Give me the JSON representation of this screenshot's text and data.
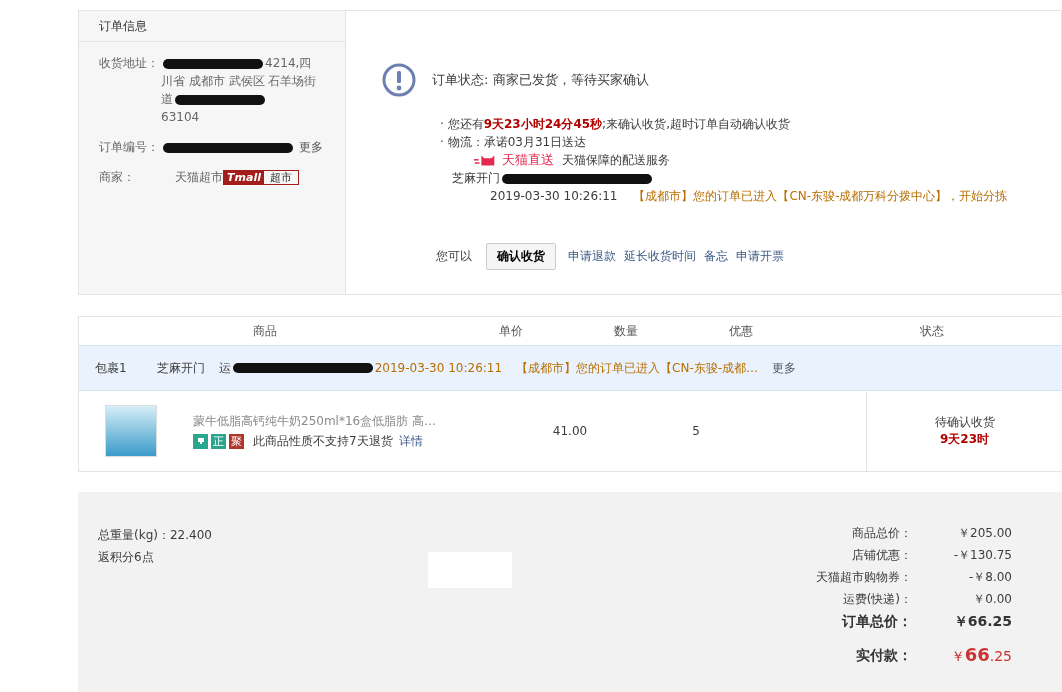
{
  "order_info": {
    "title": "订单信息",
    "fields": [
      {
        "kind": "address",
        "label": "收货地址：",
        "segments": [
          {
            "kind": "redacted"
          },
          {
            "kind": "text",
            "text": "4214,四"
          },
          {
            "kind": "text",
            "text": "川省 成都市 武侯区 石羊场街"
          },
          {
            "kind": "text",
            "text": "道"
          },
          {
            "kind": "redacted"
          },
          {
            "kind": "text",
            "text": "63104"
          }
        ]
      },
      {
        "kind": "order_no",
        "label": "订单编号：",
        "segments": [
          {
            "kind": "redacted"
          },
          {
            "kind": "more",
            "text": "更多"
          }
        ]
      },
      {
        "kind": "merchant",
        "label": "商家：",
        "segments": [
          {
            "kind": "text",
            "text": "天猫超市"
          },
          {
            "kind": "logo",
            "brand": "Tmall",
            "name": "超市"
          }
        ]
      }
    ]
  },
  "status": {
    "title": "订单状态: 商家已发货，等待买家确认",
    "bullets": [
      "· 您还有**9天23小时24分45秒**;来确认收货,超时订单自动确认收货",
      "· 物流：承诺03月31日送达"
    ],
    "delivery": {
      "badge": "天猫直送",
      "text": "天猫保障的配送服务"
    },
    "courier": {
      "text": "芝麻开门"
    },
    "track": {
      "time": "2019-03-30 10:26:11",
      "event": "【成都市】您的订单已进入【CN-东骏-成都万科分拨中心】，开始分拣"
    },
    "actions": {
      "label": "您可以",
      "button": "确认收货",
      "links": [
        "申请退款",
        "延长收货时间",
        "备忘",
        "申请开票"
      ]
    }
  },
  "table": {
    "columns": [
      "商品",
      "单价",
      "数量",
      "优惠",
      "状态"
    ],
    "package": {
      "label": "包裹1",
      "courier": "芝麻开门",
      "waybill": "运",
      "time": "2019-03-30 10:26:11",
      "event": "【成都市】您的订单已进入【CN-东骏-成都…",
      "more": "更多"
    },
    "rows": [
      {
        "name": "蒙牛低脂高钙纯牛奶250ml*16盒低脂肪 高…",
        "badges": [
          {
            "kind": "icon",
            "color": "#2aa58e"
          },
          {
            "kind": "text",
            "text": "正",
            "color": "#2aa58e"
          },
          {
            "kind": "text",
            "text": "聚",
            "color": "#b0362b"
          }
        ],
        "note": "此商品性质不支持7天退货",
        "note_link": "详情",
        "price": "41.00",
        "quantity": "5",
        "status": "待确认收货",
        "countdown": "9天23时"
      }
    ]
  },
  "summary": {
    "weight": "总重量(kg)：22.400",
    "points": "返积分6点",
    "rows": [
      {
        "kind": "normal",
        "label": "商品总价：",
        "value": "￥205.00"
      },
      {
        "kind": "normal",
        "label": "店铺优惠：",
        "value": "-￥130.75"
      },
      {
        "kind": "normal",
        "label": "天猫超市购物券：",
        "value": "-￥8.00"
      },
      {
        "kind": "normal",
        "label": "运费(快递)：",
        "value": "￥0.00"
      },
      {
        "kind": "total",
        "label": "订单总价：",
        "value": "￥66.25"
      },
      {
        "kind": "paid",
        "label": "实付款：",
        "currency": "￥",
        "value": "66",
        "cents": ".25"
      }
    ]
  }
}
